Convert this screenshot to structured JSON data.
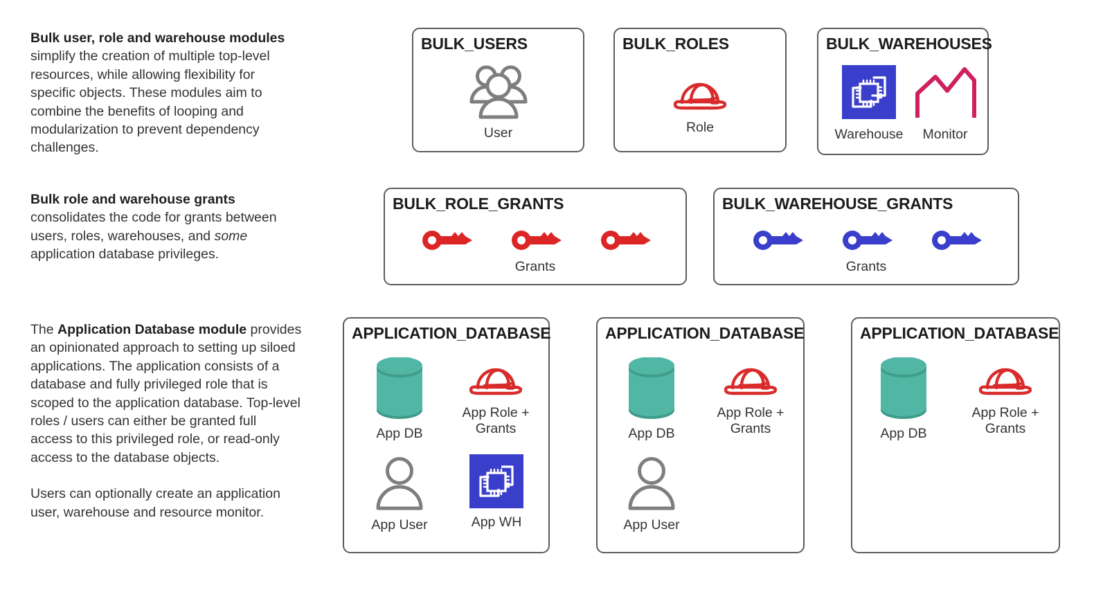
{
  "descriptions": [
    {
      "id": "bulk-modules",
      "bold_lead": "Bulk user, role and warehouse modules",
      "rest": " simplify the creation of multiple top-level resources, while allowing flexibility for specific objects. These modules aim to combine the benefits of looping and modularization to prevent dependency challenges."
    },
    {
      "id": "bulk-grants",
      "bold_lead": "Bulk role and warehouse grants",
      "rest_1": " consolidates the code for grants between users, roles, warehouses, and ",
      "italic": "some",
      "rest_2": " application database privileges."
    },
    {
      "id": "app-database",
      "prefix": "The ",
      "bold_lead": "Application Database module",
      "rest": " provides an opinionated approach to setting up siloed applications. The application consists of a database and fully privileged role that is scoped to the application database. Top-level roles / users can either be granted full access to this privileged role, or read-only access to the database objects.",
      "paragraph_2": "Users can optionally create an application user, warehouse and resource monitor."
    }
  ],
  "boxes": {
    "bulk_users": {
      "title": "BULK_USERS",
      "items": [
        {
          "icon": "users-group-icon",
          "caption": "User"
        }
      ]
    },
    "bulk_roles": {
      "title": "BULK_ROLES",
      "items": [
        {
          "icon": "hard-hat-icon",
          "caption": "Role"
        }
      ]
    },
    "bulk_warehouses": {
      "title": "BULK_WAREHOUSES",
      "items": [
        {
          "icon": "warehouse-chip-icon",
          "caption": "Warehouse"
        },
        {
          "icon": "resource-monitor-icon",
          "caption": "Monitor"
        }
      ]
    },
    "bulk_role_grants": {
      "title": "BULK_ROLE_GRANTS",
      "icon": "key-icon",
      "key_count": 3,
      "caption": "Grants"
    },
    "bulk_warehouse_grants": {
      "title": "BULK_WAREHOUSE_GRANTS",
      "icon": "key-icon",
      "key_count": 3,
      "caption": "Grants"
    },
    "application_database_1": {
      "title": "APPLICATION_DATABASE",
      "items": [
        {
          "icon": "database-cylinder-icon",
          "caption": "App DB"
        },
        {
          "icon": "hard-hat-icon",
          "caption": "App Role +\nGrants"
        },
        {
          "icon": "person-icon",
          "caption": "App User"
        },
        {
          "icon": "warehouse-chip-icon",
          "caption": "App WH"
        }
      ]
    },
    "application_database_2": {
      "title": "APPLICATION_DATABASE",
      "items": [
        {
          "icon": "database-cylinder-icon",
          "caption": "App DB"
        },
        {
          "icon": "hard-hat-icon",
          "caption": "App Role +\nGrants"
        },
        {
          "icon": "person-icon",
          "caption": "App User"
        }
      ]
    },
    "application_database_3": {
      "title": "APPLICATION_DATABASE",
      "items": [
        {
          "icon": "database-cylinder-icon",
          "caption": "App DB"
        },
        {
          "icon": "hard-hat-icon",
          "caption": "App Role +\nGrants"
        }
      ]
    }
  },
  "colors": {
    "box_border": "#5c5c5c",
    "text": "#333333",
    "title": "#1c1c1c",
    "role_red": "#D92B2B",
    "key_red": "#DC2626",
    "key_blue": "#3A3FCB",
    "warehouse_blue": "#3A3FCB",
    "monitor_pink": "#D01F5F",
    "database_teal": "#52B6A4",
    "database_teal_dark": "#3F9C8B",
    "person_gray": "#7E7E7E"
  }
}
